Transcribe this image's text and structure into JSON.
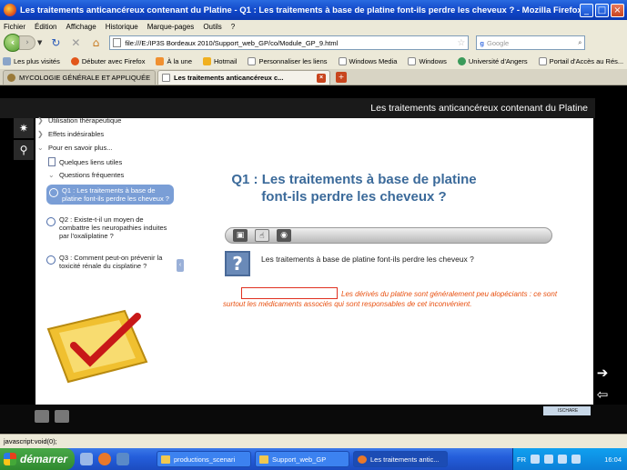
{
  "window": {
    "title": "Les traitements anticancéreux contenant du Platine - Q1 : Les traitements à base de platine font-ils perdre les cheveux ? - Mozilla Firefox"
  },
  "menu": [
    "Fichier",
    "Édition",
    "Affichage",
    "Historique",
    "Marque-pages",
    "Outils",
    "?"
  ],
  "nav": {
    "url": "file:///E:/IP3S Bordeaux 2010/Support_web_GP/co/Module_GP_9.html",
    "search_placeholder": "Google"
  },
  "bookmarks": [
    "Les plus visités",
    "Débuter avec Firefox",
    "À la une",
    "Hotmail",
    "Personnaliser les liens",
    "Windows Media",
    "Windows",
    "Université d'Angers",
    "Portail d'Accès au Rés..."
  ],
  "tabs": [
    {
      "label": "MYCOLOGIE GÉNÉRALE ET APPLIQUÉE ..."
    },
    {
      "label": "Les traitements anticancéreux c..."
    }
  ],
  "module": {
    "header": "Les traitements anticancéreux contenant du Platine"
  },
  "tree": {
    "items": [
      {
        "label": "Utilisation thérapeutique",
        "expand": ">"
      },
      {
        "label": "Effets indésirables",
        "expand": ">"
      },
      {
        "label": "Pour en savoir plus...",
        "expand": "v"
      }
    ],
    "sub_items": [
      {
        "label": "Quelques liens utiles"
      },
      {
        "label": "Questions fréquentes",
        "expand": "v"
      }
    ],
    "questions": [
      {
        "label": "Q1 : Les traitements à base de platine font-ils perdre les cheveux ?"
      },
      {
        "label": "Q2 : Existe-t-il un moyen de combattre les neuropathies induites par l'oxaliplatine ?"
      },
      {
        "label": "Q3 : Comment peut-on prévenir la toxicité rénale du cisplatine ?"
      }
    ]
  },
  "question": {
    "title": "Q1 : Les traitements à base de platine font-ils perdre les cheveux ?",
    "prompt": "Les traitements à base de platine font-ils perdre les cheveux ?",
    "answer": "Les dérivés du platine sont généralement peu alopéciants : ce sont surtout les médicaments associés qui sont responsables de cet inconvénient."
  },
  "footer": {
    "badge": "ISCHARE"
  },
  "status": {
    "text": "javascript:void(0);"
  },
  "taskbar": {
    "start": "démarrer",
    "items": [
      {
        "label": "productions_scenari"
      },
      {
        "label": "Support_web_GP"
      },
      {
        "label": "Les traitements antic..."
      }
    ],
    "lang": "FR",
    "clock": "16:04"
  }
}
